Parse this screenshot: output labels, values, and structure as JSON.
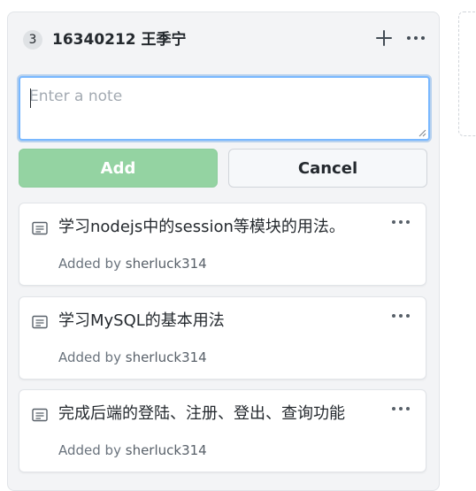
{
  "column": {
    "count": "3",
    "title": "16340212 王季宁",
    "add_icon": "plus-icon",
    "more_icon": "kebab-horizontal-icon"
  },
  "new_note": {
    "placeholder": "Enter a note",
    "value": "",
    "add_label": "Add",
    "cancel_label": "Cancel"
  },
  "cards": [
    {
      "text": "学习nodejs中的session等模块的用法。",
      "added_by_label": "Added by",
      "author": "sherluck314",
      "icon": "note-icon"
    },
    {
      "text": "学习MySQL的基本用法",
      "added_by_label": "Added by",
      "author": "sherluck314",
      "icon": "note-icon"
    },
    {
      "text": "完成后端的登陆、注册、登出、查询功能",
      "added_by_label": "Added by",
      "author": "sherluck314",
      "icon": "note-icon"
    }
  ],
  "colors": {
    "add_button": "#94d3a2",
    "focus_ring": "#79b8ff",
    "column_bg": "#f3f4f6"
  }
}
